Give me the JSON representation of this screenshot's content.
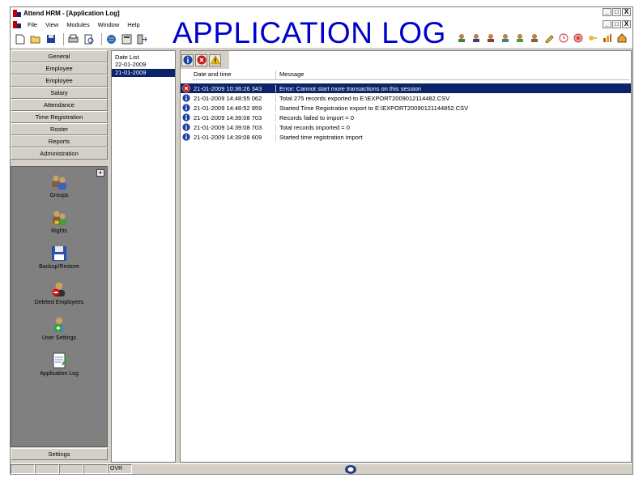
{
  "window": {
    "title": "Attend HRM - [Application Log]",
    "buttons": [
      "_",
      "□",
      "X"
    ]
  },
  "menu": {
    "items": [
      "File",
      "View",
      "Modules",
      "Window",
      "Help"
    ],
    "mdi_buttons": [
      "_",
      "□",
      "X"
    ]
  },
  "overlay_title": "APPLICATION LOG",
  "nav": {
    "buttons": [
      "General",
      "Employee",
      "Employee",
      "Salary",
      "Attendance",
      "Time Registration",
      "Roster",
      "Reports",
      "Administration"
    ],
    "panel_items": [
      {
        "label": "Groups",
        "icon": "users-icon"
      },
      {
        "label": "Rights",
        "icon": "lock-users-icon"
      },
      {
        "label": "Backup/Restore",
        "icon": "floppy-disk-icon"
      },
      {
        "label": "Deleted Employees",
        "icon": "delete-user-icon"
      },
      {
        "label": "User Settings",
        "icon": "user-settings-icon"
      },
      {
        "label": "Application Log",
        "icon": "notepad-icon"
      }
    ],
    "settings_label": "Settings"
  },
  "date_list": {
    "header": "Date List",
    "items": [
      "22-01-2009",
      "21-01-2009"
    ],
    "selected_index": 1
  },
  "log": {
    "columns": {
      "date": "Date and time",
      "message": "Message"
    },
    "rows": [
      {
        "type": "error",
        "datetime": "21-01-2009 10:36:26 343",
        "message": "Error: Cannot start more transactions on this session"
      },
      {
        "type": "info",
        "datetime": "21-01-2009 14:48:55 062",
        "message": "Total 275 records exported to E:\\EXPORT2009012114482.CSV"
      },
      {
        "type": "info",
        "datetime": "21-01-2009 14:48:52 959",
        "message": "Started Time Registration export to E:\\EXPORT20090121144852.CSV"
      },
      {
        "type": "info",
        "datetime": "21-01-2009 14:39:08 703",
        "message": "Records failed to import = 0"
      },
      {
        "type": "info",
        "datetime": "21-01-2009 14:39:08 703",
        "message": "Total records imported = 0"
      },
      {
        "type": "info",
        "datetime": "21-01-2009 14:39:08 609",
        "message": "Started time registration import"
      }
    ],
    "selected_index": 0
  },
  "status": {
    "cells": [
      "",
      "",
      "",
      "",
      "OVR"
    ]
  },
  "colors": {
    "selection": "#0a246a",
    "title_overlay": "#0000cc",
    "error": "#d01010",
    "info": "#1a3fa6",
    "warning": "#f0c000"
  }
}
